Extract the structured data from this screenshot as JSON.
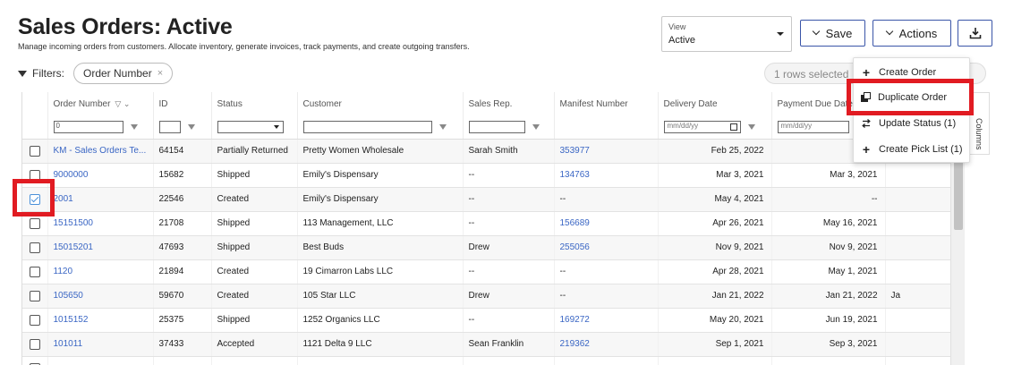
{
  "header": {
    "title": "Sales Orders: Active",
    "subtitle": "Manage incoming orders from customers. Allocate inventory, generate invoices, track payments, and create outgoing transfers."
  },
  "view": {
    "label": "View",
    "value": "Active"
  },
  "toolbar": {
    "save_label": "Save",
    "actions_label": "Actions",
    "download_icon": "download-icon"
  },
  "filters": {
    "label": "Filters:",
    "chips": [
      "Order Number"
    ],
    "chip_remove": "×"
  },
  "selection": {
    "text": "1 rows selected"
  },
  "actions_menu": {
    "items": [
      {
        "icon": "plus-icon",
        "label": "Create Order"
      },
      {
        "icon": "copy-icon",
        "label": "Duplicate Order"
      },
      {
        "icon": "swap-icon",
        "label": "Update Status (1)"
      },
      {
        "icon": "plus-icon",
        "label": "Create Pick List (1)"
      }
    ]
  },
  "grid": {
    "columns": [
      "Order Number",
      "ID",
      "Status",
      "Customer",
      "Sales Rep.",
      "Manifest Number",
      "Delivery Date",
      "Payment Due Date"
    ],
    "filter_values": {
      "order_number": "0",
      "date_placeholder": "mm/dd/yy"
    },
    "rows": [
      {
        "order": "KM - Sales Orders Te...",
        "id": "64154",
        "status": "Partially Returned",
        "customer": "Pretty Women Wholesale",
        "rep": "Sarah Smith",
        "manifest": "353977",
        "delivery": "Feb 25, 2022",
        "payment": "",
        "extra": "",
        "checked": false
      },
      {
        "order": "9000000",
        "id": "15682",
        "status": "Shipped",
        "customer": "Emily's Dispensary",
        "rep": "--",
        "manifest": "134763",
        "delivery": "Mar 3, 2021",
        "payment": "Mar 3, 2021",
        "extra": "",
        "checked": false
      },
      {
        "order": "2001",
        "id": "22546",
        "status": "Created",
        "customer": "Emily's Dispensary",
        "rep": "--",
        "manifest": "--",
        "delivery": "May 4, 2021",
        "payment": "--",
        "extra": "",
        "checked": true
      },
      {
        "order": "15151500",
        "id": "21708",
        "status": "Shipped",
        "customer": "113 Management, LLC",
        "rep": "--",
        "manifest": "156689",
        "delivery": "Apr 26, 2021",
        "payment": "May 16, 2021",
        "extra": "",
        "checked": false
      },
      {
        "order": "15015201",
        "id": "47693",
        "status": "Shipped",
        "customer": "Best Buds",
        "rep": "Drew",
        "manifest": "255056",
        "delivery": "Nov 9, 2021",
        "payment": "Nov 9, 2021",
        "extra": "",
        "checked": false
      },
      {
        "order": "1120",
        "id": "21894",
        "status": "Created",
        "customer": "19 Cimarron Labs LLC",
        "rep": "--",
        "manifest": "--",
        "delivery": "Apr 28, 2021",
        "payment": "May 1, 2021",
        "extra": "",
        "checked": false
      },
      {
        "order": "105650",
        "id": "59670",
        "status": "Created",
        "customer": "105 Star LLC",
        "rep": "Drew",
        "manifest": "--",
        "delivery": "Jan 21, 2022",
        "payment": "Jan 21, 2022",
        "extra": "Ja",
        "checked": false
      },
      {
        "order": "1015152",
        "id": "25375",
        "status": "Shipped",
        "customer": "1252 Organics LLC",
        "rep": "--",
        "manifest": "169272",
        "delivery": "May 20, 2021",
        "payment": "Jun 19, 2021",
        "extra": "",
        "checked": false
      },
      {
        "order": "101011",
        "id": "37433",
        "status": "Accepted",
        "customer": "1121 Delta 9 LLC",
        "rep": "Sean Franklin",
        "manifest": "219362",
        "delivery": "Sep 1, 2021",
        "payment": "Sep 3, 2021",
        "extra": "",
        "checked": false
      },
      {
        "order": "",
        "id": "",
        "status": "",
        "customer": "",
        "rep": "",
        "manifest": "",
        "delivery": "",
        "payment": "",
        "extra": "",
        "checked": false
      }
    ]
  },
  "side_panel": {
    "columns_label": "Columns"
  },
  "colors": {
    "accent": "#3a55a8",
    "link": "#3a66c4",
    "highlight": "#e11b22",
    "check": "#4a90d9"
  }
}
